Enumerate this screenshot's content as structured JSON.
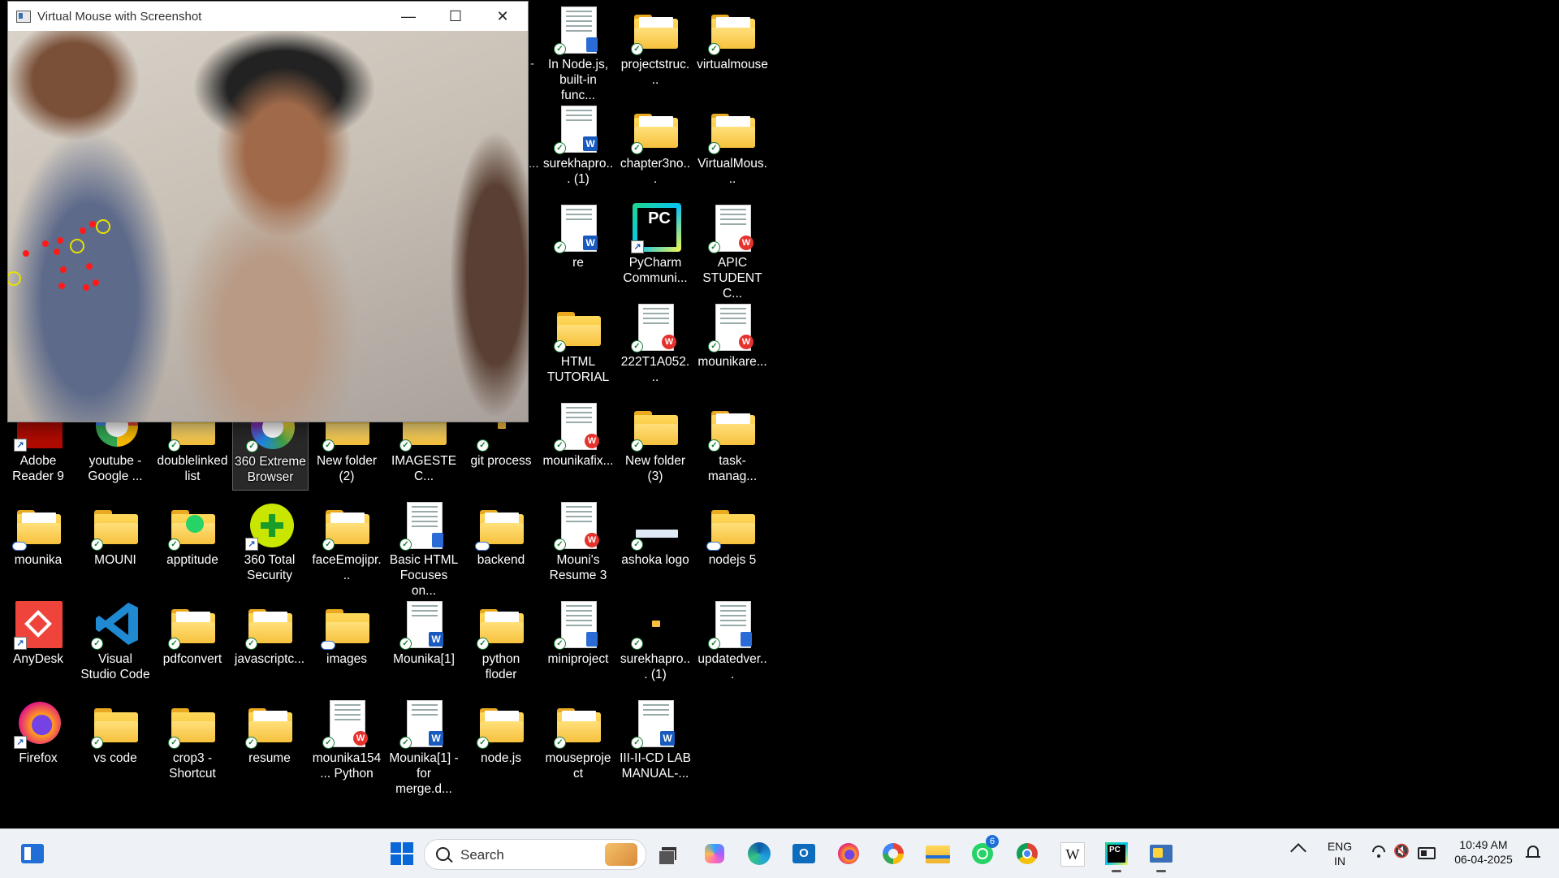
{
  "window": {
    "title": "Virtual Mouse with Screenshot",
    "controls": {
      "minimize": "—",
      "maximize": "☐",
      "close": "✕"
    }
  },
  "desktop": {
    "col1": [
      {
        "label": "Adobe Reader 9",
        "kind": "adobe"
      },
      {
        "label": "mounika",
        "kind": "folder-doc",
        "status": "cloud"
      },
      {
        "label": "AnyDesk",
        "kind": "anydesk"
      },
      {
        "label": "Firefox",
        "kind": "firefox"
      }
    ],
    "col2": [
      {
        "label": "youtube - Google ...",
        "kind": "google"
      },
      {
        "label": "MOUNI",
        "kind": "folder"
      },
      {
        "label": "Visual Studio Code",
        "kind": "vscode"
      },
      {
        "label": "vs code",
        "kind": "folder"
      }
    ],
    "col3": [
      {
        "label": "doublelinked list",
        "kind": "folder"
      },
      {
        "label": "apptitude",
        "kind": "folder-whatsapp"
      },
      {
        "label": "pdfconvert",
        "kind": "folder-doc"
      },
      {
        "label": "crop3 - Shortcut",
        "kind": "folder"
      }
    ],
    "col4": [
      {
        "label": "360 Extreme Browser",
        "kind": "360browser"
      },
      {
        "label": "360 Total Security",
        "kind": "360security"
      },
      {
        "label": "javascriptc...",
        "kind": "folder-doc"
      },
      {
        "label": "resume",
        "kind": "folder-doc"
      }
    ],
    "col5": [
      {
        "label": "New folder (2)",
        "kind": "folder"
      },
      {
        "label": "faceEmojipr...",
        "kind": "folder-doc"
      },
      {
        "label": "images",
        "kind": "folder",
        "status": "cloud"
      },
      {
        "label": "mounika154... Python",
        "kind": "doc-wps"
      }
    ],
    "col6": [
      {
        "label": "IMAGESTEC...",
        "kind": "folder"
      },
      {
        "label": "Basic HTML Focuses on...",
        "kind": "doc-note"
      },
      {
        "label": "Mounika[1]",
        "kind": "doc-word"
      },
      {
        "label": "Mounika[1] - for merge.d...",
        "kind": "doc-word"
      }
    ],
    "col7": [
      {
        "label": "git process",
        "kind": "tiny-folder"
      },
      {
        "label": "backend",
        "kind": "folder-doc",
        "status": "cloud"
      },
      {
        "label": "python floder",
        "kind": "folder-doc"
      },
      {
        "label": "node.js",
        "kind": "folder-doc"
      }
    ],
    "col8": [
      {
        "label": "In Node.js, built-in func...",
        "kind": "doc-note"
      },
      {
        "label": "surekhapro... (1)",
        "kind": "doc-word"
      },
      {
        "label": "re",
        "kind": "doc-word"
      },
      {
        "label": "HTML TUTORIAL",
        "kind": "folder"
      },
      {
        "label": "mounikafix...",
        "kind": "doc-wps"
      },
      {
        "label": "Mouni's Resume 3",
        "kind": "doc-wps"
      },
      {
        "label": "miniproject",
        "kind": "doc-note"
      },
      {
        "label": "mouseproject",
        "kind": "folder-doc"
      }
    ],
    "col9": [
      {
        "label": "projectstruc...",
        "kind": "folder-doc"
      },
      {
        "label": "chapter3no...",
        "kind": "folder-doc"
      },
      {
        "label": "PyCharm Communi...",
        "kind": "pycharm"
      },
      {
        "label": "222T1A052...",
        "kind": "doc-wps"
      },
      {
        "label": "New folder (3)",
        "kind": "folder"
      },
      {
        "label": "ashoka logo",
        "kind": "ashoka"
      },
      {
        "label": "surekhapro... (1)",
        "kind": "tiny-folder"
      },
      {
        "label": "III-II-CD LAB MANUAL-...",
        "kind": "doc-word"
      }
    ],
    "col10": [
      {
        "label": "virtualmouse",
        "kind": "folder-doc"
      },
      {
        "label": "VirtualMous...",
        "kind": "folder-doc"
      },
      {
        "label": "APIC STUDENT C...",
        "kind": "doc-wps"
      },
      {
        "label": "mounikare...",
        "kind": "doc-wps"
      },
      {
        "label": "task-manag...",
        "kind": "folder-doc"
      },
      {
        "label": "nodejs 5",
        "kind": "folder",
        "status": "cloud"
      },
      {
        "label": "updatedver...",
        "kind": "doc-note"
      }
    ],
    "partial_labels": {
      "dash": "-",
      "dots": "..."
    }
  },
  "taskbar": {
    "search_placeholder": "Search",
    "pinned": [
      "task-view-icon",
      "copilot-icon",
      "edge-icon",
      "outlook-icon",
      "firefox-icon",
      "google-icon",
      "file-explorer-icon",
      "whatsapp-icon",
      "chrome-icon",
      "wikipedia-icon",
      "pycharm-icon",
      "python-idle-icon"
    ],
    "whatsapp_badge": "6",
    "language": "ENG",
    "region": "IN",
    "time": "10:49 AM",
    "date": "06-04-2025"
  }
}
